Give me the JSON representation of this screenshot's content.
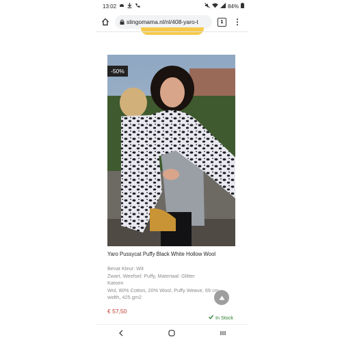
{
  "status_bar": {
    "time": "13:02",
    "battery": "84%"
  },
  "browser": {
    "url": "slingomama.nl/nl/408-yaro-t",
    "tab_count": "1"
  },
  "product": {
    "badge": "-50%",
    "title": "Yaro Pussycat Puffy Black White Hollow Wool",
    "description_lines": [
      "Bevat Kleur: Wit",
      "Zwart, Weefsel: Puffy, Materiaal: Glitter",
      "Katoen",
      "Wol, 80% Cotton, 20% Wool, Puffy Weave, 69 cm",
      "width, 425 gm2"
    ],
    "price": "€ 57,50",
    "stock": "In Stock"
  },
  "colors": {
    "accent_yellow": "#f5c94a",
    "price_red": "#c0392b",
    "stock_green": "#2e7d32"
  },
  "icons": [
    "alarm-icon",
    "download-icon",
    "phone-icon",
    "mute-icon",
    "wifi-icon",
    "signal-icon",
    "battery-icon",
    "home-icon",
    "lock-icon",
    "menu-dots-icon",
    "back-icon",
    "nav-home-icon",
    "recents-icon",
    "arrow-up-icon",
    "check-icon"
  ]
}
